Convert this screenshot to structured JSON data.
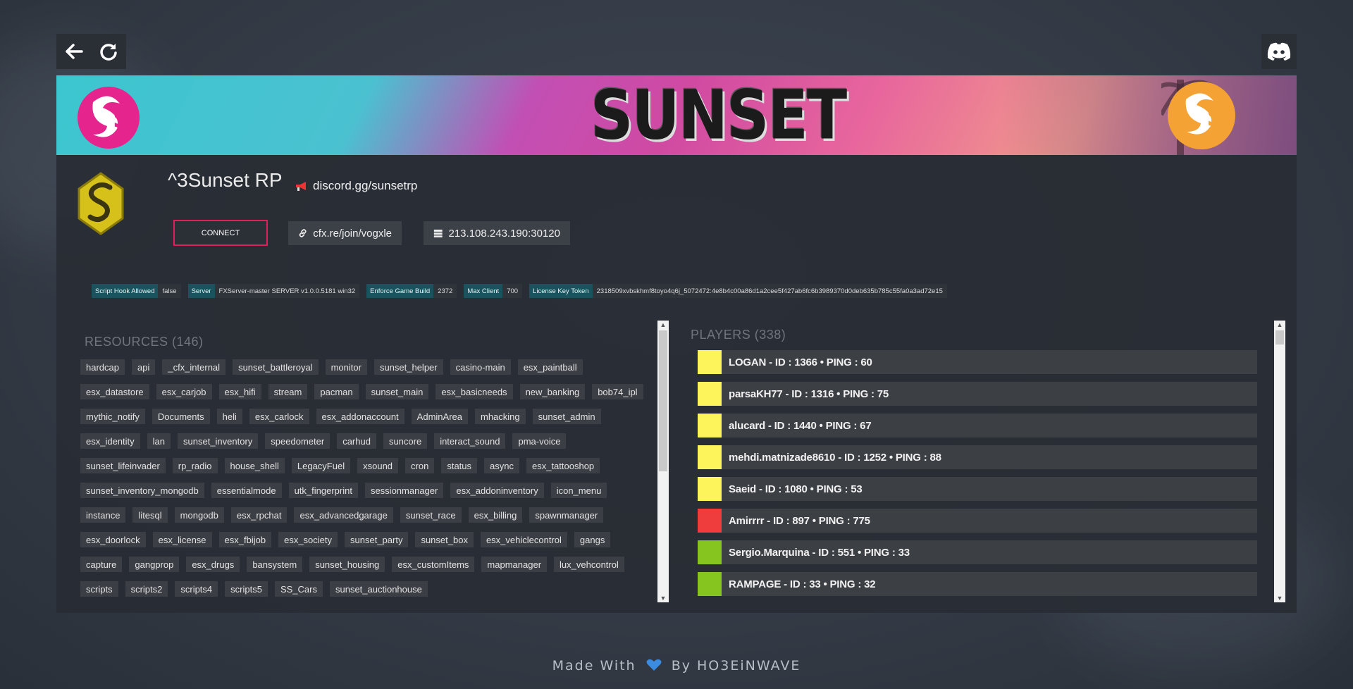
{
  "nav": {
    "back_icon": "arrow-left-icon",
    "refresh_icon": "refresh-icon",
    "discord_icon": "discord-icon"
  },
  "banner": {
    "title": "SUNSET"
  },
  "server": {
    "name": "^3Sunset RP",
    "subtitle": "discord.gg/sunsetrp",
    "subtitle_icon": "megaphone-icon"
  },
  "actions": {
    "connect_label": "CONNECT",
    "join_link": "cfx.re/join/vogxle",
    "join_icon": "link-icon",
    "address": "213.108.243.190:30120",
    "address_icon": "server-icon"
  },
  "badges": [
    {
      "key": "Script Hook Allowed",
      "value": "false"
    },
    {
      "key": "Server",
      "value": "FXServer-master SERVER v1.0.0.5181 win32"
    },
    {
      "key": "Enforce Game Build",
      "value": "2372"
    },
    {
      "key": "Max Client",
      "value": "700"
    },
    {
      "key": "License Key Token",
      "value": "2318509xvbskhmf8toyo4q6j_5072472:4e8b4c00a86d1a2cee5f427ab6fc6b3989370d0deb635b785c55fa0a3ad72e15"
    }
  ],
  "resources": {
    "title": "RESOURCES (146)",
    "items": [
      "hardcap",
      "api",
      "_cfx_internal",
      "sunset_battleroyal",
      "monitor",
      "sunset_helper",
      "casino-main",
      "esx_paintball",
      "esx_datastore",
      "esx_carjob",
      "esx_hifi",
      "stream",
      "pacman",
      "sunset_main",
      "esx_basicneeds",
      "new_banking",
      "bob74_ipl",
      "mythic_notify",
      "Documents",
      "heli",
      "esx_carlock",
      "esx_addonaccount",
      "AdminArea",
      "mhacking",
      "sunset_admin",
      "esx_identity",
      "lan",
      "sunset_inventory",
      "speedometer",
      "carhud",
      "suncore",
      "interact_sound",
      "pma-voice",
      "sunset_lifeinvader",
      "rp_radio",
      "house_shell",
      "LegacyFuel",
      "xsound",
      "cron",
      "status",
      "async",
      "esx_tattooshop",
      "sunset_inventory_mongodb",
      "essentialmode",
      "utk_fingerprint",
      "sessionmanager",
      "esx_addoninventory",
      "icon_menu",
      "instance",
      "litesql",
      "mongodb",
      "esx_rpchat",
      "esx_advancedgarage",
      "sunset_race",
      "esx_billing",
      "spawnmanager",
      "esx_doorlock",
      "esx_license",
      "esx_fbijob",
      "esx_society",
      "sunset_party",
      "sunset_box",
      "esx_vehiclecontrol",
      "gangs",
      "capture",
      "gangprop",
      "esx_drugs",
      "bansystem",
      "sunset_housing",
      "esx_customItems",
      "mapmanager",
      "lux_vehcontrol",
      "scripts",
      "scripts2",
      "scripts4",
      "scripts5",
      "SS_Cars",
      "sunset_auctionhouse"
    ]
  },
  "players": {
    "title": "PLAYERS (338)",
    "items": [
      {
        "label": "LOGAN - ID : 1366 • PING : 60",
        "color": "#fdf35a"
      },
      {
        "label": "parsaKH77 - ID : 1316 • PING : 75",
        "color": "#fdf35a"
      },
      {
        "label": "alucard - ID : 1440 • PING : 67",
        "color": "#fdf35a"
      },
      {
        "label": "mehdi.matnizade8610 - ID : 1252 • PING : 88",
        "color": "#fdf35a"
      },
      {
        "label": "Saeid - ID : 1080 • PING : 53",
        "color": "#fdf35a"
      },
      {
        "label": "Amirrrr - ID : 897 • PING : 775",
        "color": "#ef3c3c"
      },
      {
        "label": "Sergio.Marquina - ID : 551 • PING : 33",
        "color": "#86c51f"
      },
      {
        "label": "RAMPAGE - ID : 33 • PING : 32",
        "color": "#86c51f"
      }
    ]
  },
  "footer": {
    "prefix": "Made With",
    "heart_icon": "heart-icon",
    "suffix": "By HO3EiNWAVE"
  },
  "colors": {
    "accent": "#e0205a",
    "badge_key": "#18535e",
    "heart": "#3b8be0"
  }
}
